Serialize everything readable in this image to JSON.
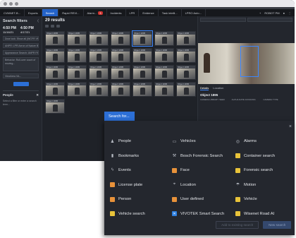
{
  "tabs": [
    {
      "label": "CVMNET-B..."
    },
    {
      "label": "Exports"
    },
    {
      "label": "Search"
    },
    {
      "label": "Rapid REVI..."
    },
    {
      "label": "Alarm..."
    },
    {
      "label": "Incidents"
    },
    {
      "label": "LPR"
    },
    {
      "label": "Evidence"
    },
    {
      "label": "Task intelli..."
    },
    {
      "label": "LPRO Auto..."
    }
  ],
  "alarm_badge": "3",
  "topbar_user": "ROBOT PM",
  "sidebar": {
    "title": "Search filters",
    "time_from": "4:50 PM",
    "time_to": "4:50 PM",
    "time_from_date": "11/16/21",
    "time_to_date": "4/17/21",
    "fields": [
      "Door lock: Show all (WCFR VMS, D...",
      "ANPR: LPR Aeron of Nature B...",
      "Appearance Search: ANPR PALM 10",
      "Behavior: Roll-over count of moving...",
      "ViewArea VA..."
    ],
    "people_title": "People",
    "people_text": "Select a filter or enter a search term..."
  },
  "results": {
    "title": "29 results",
    "thumb_caption": "Object 1895"
  },
  "detail": {
    "tab_details": "Details",
    "tab_location": "Location",
    "object_title": "Object 1895",
    "meta": [
      "CAMERA LIBRARY SEEK",
      "ALPHA DATE 10/19/2021",
      "CAMERA TYPE"
    ]
  },
  "overlay": {
    "tab_label": "Search for...",
    "close": "×",
    "options": [
      {
        "label": "People",
        "icon": "person-icon",
        "style": "plain"
      },
      {
        "label": "Vehicles",
        "icon": "car-icon",
        "style": "plain"
      },
      {
        "label": "Alarms",
        "icon": "alarm-icon",
        "style": "plain"
      },
      {
        "label": "Bookmarks",
        "icon": "bookmark-icon",
        "style": "plain"
      },
      {
        "label": "Bosch Forensic Search",
        "icon": "tool-icon",
        "style": "plain"
      },
      {
        "label": "Container search",
        "icon": "container-icon",
        "style": "yellow"
      },
      {
        "label": "Events",
        "icon": "bolt-icon",
        "style": "plain"
      },
      {
        "label": "Face",
        "icon": "face-icon",
        "style": "orange"
      },
      {
        "label": "Forensic search",
        "icon": "forensic-icon",
        "style": "yellow"
      },
      {
        "label": "License plate",
        "icon": "plate-icon",
        "style": "orange"
      },
      {
        "label": "Location",
        "icon": "location-icon",
        "style": "plain"
      },
      {
        "label": "Motion",
        "icon": "motion-icon",
        "style": "plain"
      },
      {
        "label": "Person",
        "icon": "person-search-icon",
        "style": "orange"
      },
      {
        "label": "User defined",
        "icon": "user-defined-icon",
        "style": "orange"
      },
      {
        "label": "Vehicle",
        "icon": "vehicle-search-icon",
        "style": "yellow"
      },
      {
        "label": "Vehicle search",
        "icon": "vehicle-search-plugin-icon",
        "style": "yellow"
      },
      {
        "label": "VIVOTEK Smart Search",
        "icon": "vivotek-icon",
        "style": "blue"
      },
      {
        "label": "Wisenet Road AI",
        "icon": "wisenet-icon",
        "style": "yellow"
      }
    ],
    "add_button": "Add to existing search",
    "new_button": "New search"
  },
  "colors": {
    "accent": "#2c6fd6",
    "orange_icon": "#e8923a",
    "yellow_icon": "#e8c33a",
    "panel_bg": "#24272e"
  }
}
